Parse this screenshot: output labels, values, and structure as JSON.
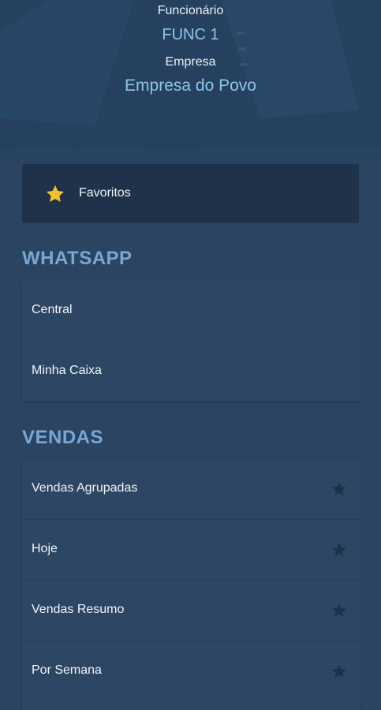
{
  "header": {
    "employee_label": "Funcionário",
    "employee_value": "FUNC 1",
    "company_label": "Empresa",
    "company_value": "Empresa do Povo"
  },
  "favorites": {
    "label": "Favoritos",
    "icon": "star-icon",
    "icon_color": "#f2c12e"
  },
  "sections": [
    {
      "title": "WHATSAPP",
      "items": [
        {
          "label": "Central"
        },
        {
          "label": "Minha Caixa"
        }
      ]
    },
    {
      "title": "VENDAS",
      "items": [
        {
          "label": "Vendas Agrupadas",
          "icon": "star-icon"
        },
        {
          "label": "Hoje",
          "icon": "star-icon"
        },
        {
          "label": "Vendas Resumo",
          "icon": "star-icon"
        },
        {
          "label": "Por Semana",
          "icon": "star-icon"
        }
      ]
    }
  ],
  "colors": {
    "background": "#2a4462",
    "accent_text": "#8fc4ec",
    "section_title": "#7aa6d2",
    "favorites_card": "#1f324a",
    "inactive_star": "#1e3148"
  }
}
